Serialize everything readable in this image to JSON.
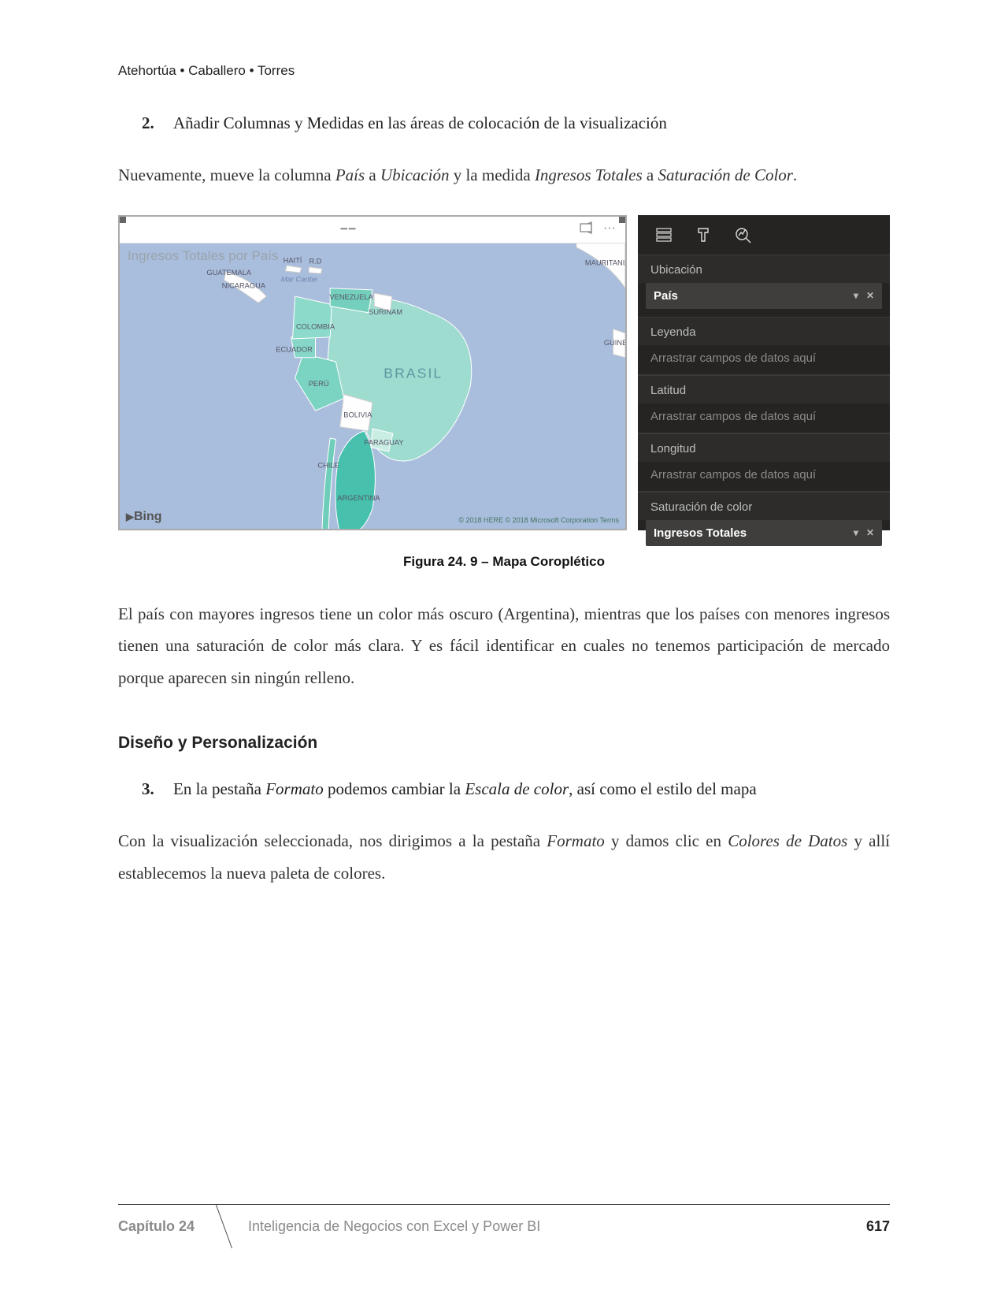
{
  "header": {
    "authors": "Atehortúa • Caballero • Torres"
  },
  "step2": {
    "num": "2.",
    "text": "Añadir Columnas y Medidas en las áreas de colocación de la visualización"
  },
  "para1_parts": {
    "a": "Nuevamente, mueve la columna ",
    "pais": "País",
    "b": " a ",
    "ubic": "Ubicación",
    "c": " y la medida ",
    "ing": "Ingresos Totales",
    "d": " a ",
    "sat": "Saturación de Color",
    "e": "."
  },
  "powerbi": {
    "card_title": "Ingresos Totales por País",
    "attribution": "© 2018 HERE © 2018 Microsoft Corporation Terms",
    "bing": "Bing",
    "ellipsis": "···",
    "panel": {
      "well_ubicacion": "Ubicación",
      "pill_pais": "País",
      "well_leyenda": "Leyenda",
      "placeholder": "Arrastrar campos de datos aquí",
      "well_latitud": "Latitud",
      "well_longitud": "Longitud",
      "well_sat": "Saturación de color",
      "pill_ingresos": "Ingresos Totales"
    },
    "map_labels": {
      "brasil": "BRASIL",
      "venezuela": "VENEZUELA",
      "colombia": "COLOMBIA",
      "ecuador": "ECUADOR",
      "peru": "PERÚ",
      "bolivia": "BOLIVIA",
      "chile": "CHILE",
      "argentina": "ARGENTINA",
      "paraguay": "PARAGUAY",
      "guatemala": "GUATEMALA",
      "nicaragua": "NICARAGUA",
      "haiti": "HAITÍ",
      "rd": "R.D",
      "surinam": "SURINAM",
      "guinea": "GUINEA",
      "mauritania": "MAURITANIA",
      "marcaribe": "Mar Caribe"
    }
  },
  "caption": "Figura 24. 9 – Mapa Coroplético",
  "para2": "El país con mayores ingresos tiene un color más oscuro (Argentina), mientras que los países con menores ingresos tienen una saturación de color más clara. Y es fácil identificar en cuales no tenemos participación de mercado porque aparecen sin ningún relleno.",
  "section_heading": "Diseño y Personalización",
  "step3": {
    "num": "3.",
    "parts": {
      "a": "En la pestaña ",
      "formato": "Formato",
      "b": " podemos cambiar la ",
      "escala": "Escala de color",
      "c": ", así como el estilo del mapa"
    }
  },
  "para3_parts": {
    "a": "Con la visualización seleccionada, nos dirigimos a la pestaña ",
    "formato": "Formato",
    "b": " y damos clic en ",
    "colores": "Colores de Datos",
    "c": " y allí establecemos la nueva paleta de colores."
  },
  "footer": {
    "chapter": "Capítulo 24",
    "title": "Inteligencia de Negocios con Excel y Power BI",
    "page": "617"
  }
}
